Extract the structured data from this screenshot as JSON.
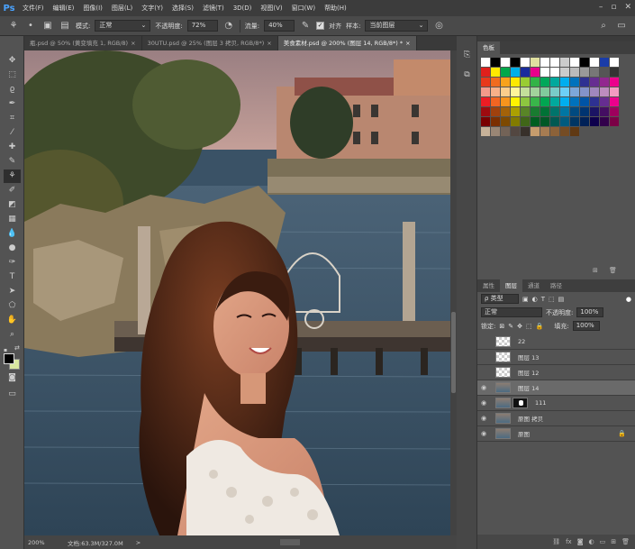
{
  "app": {
    "logo": "Ps"
  },
  "menu": [
    "文件(F)",
    "编辑(E)",
    "图像(I)",
    "图层(L)",
    "文字(Y)",
    "选择(S)",
    "滤镜(T)",
    "3D(D)",
    "视图(V)",
    "窗口(W)",
    "帮助(H)"
  ],
  "options": {
    "mode_label": "模式:",
    "mode_value": "正常",
    "opacity_label": "不透明度:",
    "opacity_value": "72%",
    "flow_label": "流量:",
    "flow_value": "40%",
    "aligned_label": "对齐",
    "sample_label": "样本:",
    "sample_value": "当前图层"
  },
  "tabs": [
    {
      "label": "瓶.psd @ 50% (黄变填充 1, RGB/8)",
      "close": "×"
    },
    {
      "label": "30UTU.psd @ 25% (图层 3 拷贝, RGB/8*)",
      "close": "×"
    },
    {
      "label": "美食素材.psd @ 200% (图层 14, RGB/8*) *",
      "close": "×"
    }
  ],
  "status": {
    "zoom": "200%",
    "doc": "文档:63.3M/327.0M",
    "arrow": ">"
  },
  "swatches_panel": {
    "title": "色板"
  },
  "layers_panel": {
    "tabs": [
      "属性",
      "图层",
      "通道",
      "路径"
    ],
    "filter_label": "ρ 类型",
    "blend_mode": "正常",
    "opacity_label": "不透明度:",
    "opacity_value": "100%",
    "lock_label": "锁定:",
    "fill_label": "填充:",
    "fill_value": "100%",
    "layers": [
      {
        "name": "22",
        "visible": false,
        "thumb": "checker",
        "selected": false
      },
      {
        "name": "图层 13",
        "visible": false,
        "thumb": "checker",
        "selected": false
      },
      {
        "name": "图层 12",
        "visible": false,
        "thumb": "checker",
        "selected": false
      },
      {
        "name": "图层 14",
        "visible": true,
        "thumb": "photo",
        "selected": true
      },
      {
        "name": "111",
        "visible": true,
        "thumb": "photo",
        "selected": false,
        "mask": true
      },
      {
        "name": "原图 拷贝",
        "visible": true,
        "thumb": "photo",
        "selected": false
      },
      {
        "name": "原图",
        "visible": true,
        "thumb": "photo",
        "selected": false,
        "locked": true
      }
    ]
  },
  "colors": {
    "accent": "#4aa3ff",
    "panel_bg": "#535353",
    "menubar_bg": "#3c3c3c"
  }
}
